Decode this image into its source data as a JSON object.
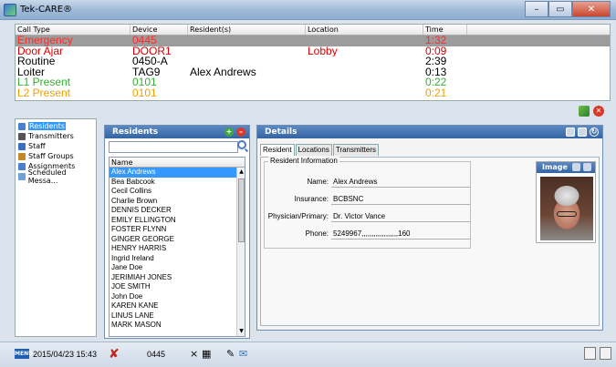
{
  "window": {
    "title": "Tek-CARE®",
    "buttons": {
      "minimize": "–",
      "maximize": "▭",
      "close": "✕"
    }
  },
  "calls": {
    "headers": [
      "Call Type",
      "Device",
      "Resident(s)",
      "Location",
      "Time"
    ],
    "rows": [
      {
        "type": "Emergency",
        "device": "0445",
        "resident": "",
        "location": "",
        "time": "1:32",
        "color": "#ff2a2a"
      },
      {
        "type": "Door Ajar",
        "device": "DOOR1",
        "resident": "",
        "location": "Lobby",
        "time": "0:09",
        "color": "#d80000"
      },
      {
        "type": "Routine",
        "device": "0450-A",
        "resident": "",
        "location": "",
        "time": "2:39",
        "color": "#000000"
      },
      {
        "type": "Loiter",
        "device": "TAG9",
        "resident": "Alex Andrews",
        "location": "",
        "time": "0:13",
        "color": "#000000"
      },
      {
        "type": "L1 Present",
        "device": "0101",
        "resident": "",
        "location": "",
        "time": "0:22",
        "color": "#33b033"
      },
      {
        "type": "L2 Present",
        "device": "0101",
        "resident": "",
        "location": "",
        "time": "0:21",
        "color": "#f0a000"
      }
    ]
  },
  "nav": {
    "items": [
      {
        "label": "Residents",
        "icon": "residents-icon",
        "selected": true
      },
      {
        "label": "Transmitters",
        "icon": "transmitter-icon"
      },
      {
        "label": "Staff",
        "icon": "staff-icon"
      },
      {
        "label": "Staff Groups",
        "icon": "staff-groups-icon"
      },
      {
        "label": "Assignments",
        "icon": "assignments-icon"
      },
      {
        "label": "Scheduled Messa...",
        "icon": "scheduled-messages-icon"
      }
    ]
  },
  "residents": {
    "title": "Residents",
    "search_value": "",
    "column": "Name",
    "names": [
      "Alex Andrews",
      "Bea Babcook",
      "Cecil Collins",
      "Charlie Brown",
      "DENNIS DECKER",
      "EMILY ELLINGTON",
      "FOSTER FLYNN",
      "GINGER GEORGE",
      "HENRY  HARRIS",
      "Ingrid Ireland",
      "Jane Doe",
      "JERIMIAH JONES",
      "JOE SMITH",
      "John Doe",
      "KAREN KANE",
      "LINUS LANE",
      "MARK MASON"
    ]
  },
  "details": {
    "title": "Details",
    "tabs": [
      "Resident",
      "Locations",
      "Transmitters"
    ],
    "section_title": "Resident Information",
    "fields": [
      {
        "label": "Name:",
        "value": "Alex Andrews"
      },
      {
        "label": "Insurance:",
        "value": "BCBSNC"
      },
      {
        "label": "Physician/Primary:",
        "value": "Dr. Victor Vance"
      },
      {
        "label": "Phone:",
        "value": "5249967,,,,,,,,,,,,,,,,,,160"
      }
    ],
    "image_title": "Image"
  },
  "status": {
    "menu_label": "MENU",
    "date": "2015/04/23 15:43",
    "device": "0445",
    "small_x": "×"
  }
}
